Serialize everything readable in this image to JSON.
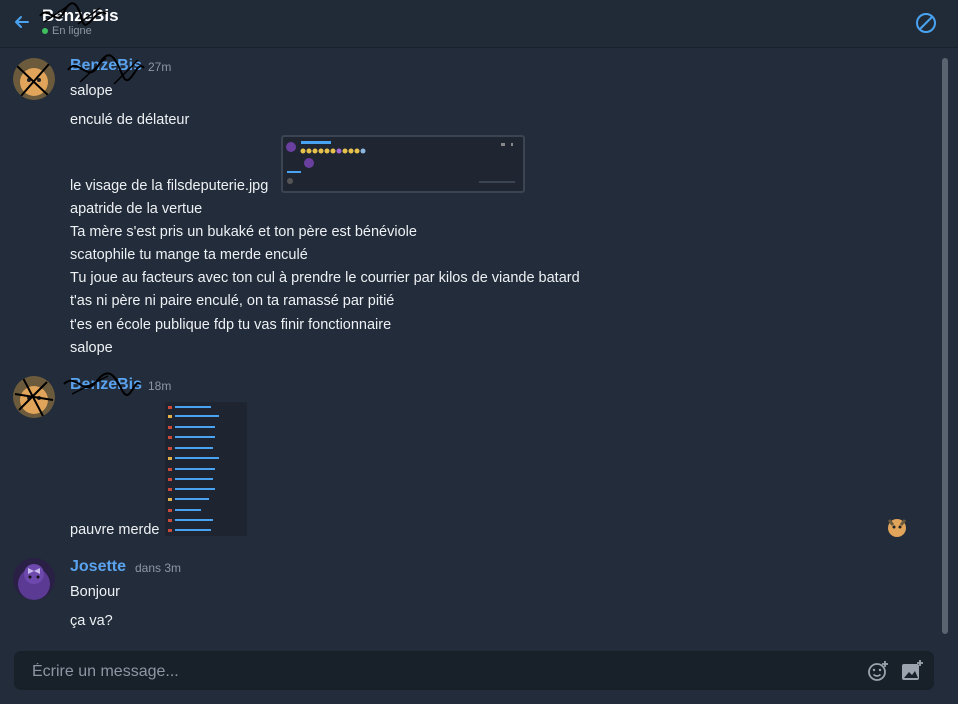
{
  "header": {
    "contact_name": "BenzeBis",
    "status_text": "En ligne",
    "back_icon": "arrow-left-icon",
    "block_icon": "block-icon",
    "accent_color": "#4aa3f0",
    "online_color": "#3fbf5f"
  },
  "messages": [
    {
      "author": "BenzeBis",
      "time": "27m",
      "avatar_icon": "cat-avatar",
      "lines": [
        "salope",
        "enculé de délateur"
      ],
      "attachment_caption": "le visage de la filsdeputerie.jpg",
      "lines_after": [
        "apatride de la vertue",
        "Ta mère s'est pris un bukaké et ton père est bénéviole",
        "scatophile tu mange ta merde enculé",
        "Tu joue au facteurs avec ton cul à prendre le courrier par kilos de viande batard",
        "t'as ni père ni paire enculé, on ta ramassé par pitié",
        "t'es en école publique fdp tu vas finir fonctionnaire",
        "salope"
      ]
    },
    {
      "author": "BenzeBis",
      "time": "18m",
      "avatar_icon": "cat-avatar",
      "lines": [
        "pauvre merde"
      ],
      "reaction_icon": "cat-avatar"
    },
    {
      "author": "Josette",
      "time": "dans 3m",
      "avatar_icon": "purple-character-avatar",
      "lines": [
        "Bonjour",
        "ça va?"
      ]
    }
  ],
  "composer": {
    "placeholder": "Écrire un message...",
    "emoji_icon": "emoji-add-icon",
    "image_icon": "image-add-icon"
  }
}
